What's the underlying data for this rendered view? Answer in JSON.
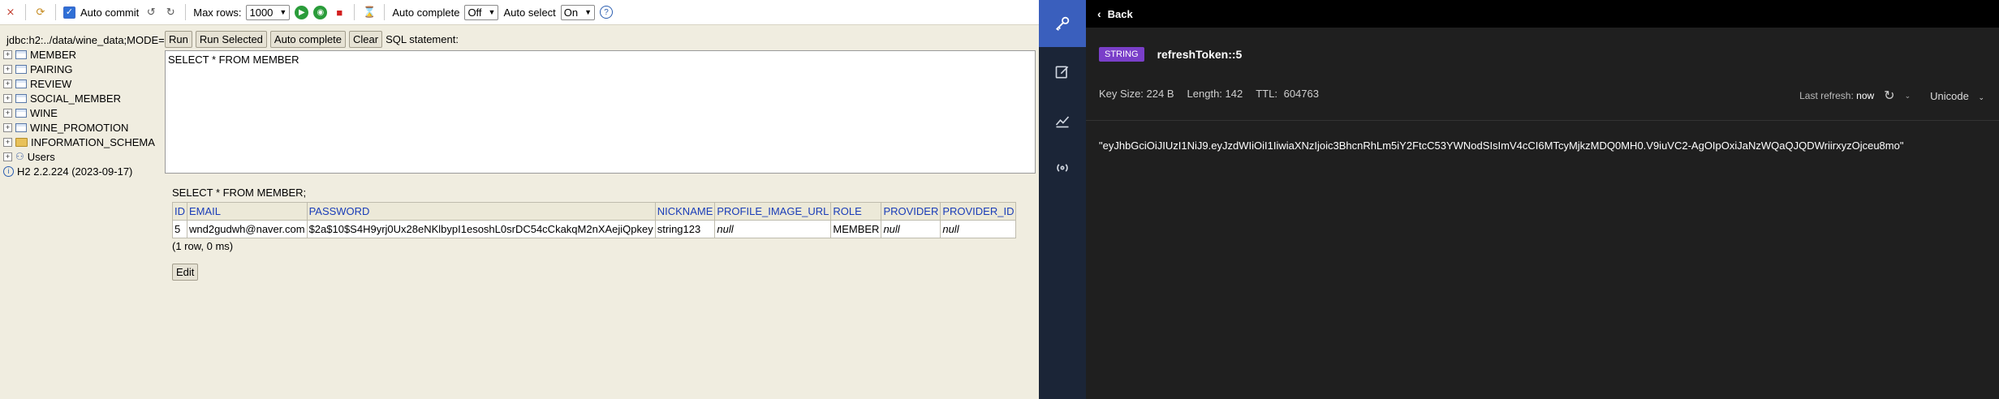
{
  "h2": {
    "toolbar": {
      "auto_commit": "Auto commit",
      "max_rows_label": "Max rows:",
      "max_rows_value": "1000",
      "auto_complete_label": "Auto complete",
      "auto_complete_value": "Off",
      "auto_select_label": "Auto select",
      "auto_select_value": "On"
    },
    "tree": {
      "connection": "jdbc:h2:../data/wine_data;MODE=",
      "tables": [
        "MEMBER",
        "PAIRING",
        "REVIEW",
        "SOCIAL_MEMBER",
        "WINE",
        "WINE_PROMOTION"
      ],
      "schema": "INFORMATION_SCHEMA",
      "users": "Users",
      "version": "H2 2.2.224 (2023-09-17)"
    },
    "sql_toolbar": {
      "run": "Run",
      "run_selected": "Run Selected",
      "auto_complete": "Auto complete",
      "clear": "Clear",
      "statement_label": "SQL statement:"
    },
    "editor_text": "SELECT * FROM MEMBER",
    "result": {
      "query": "SELECT * FROM MEMBER;",
      "columns": [
        "ID",
        "EMAIL",
        "PASSWORD",
        "NICKNAME",
        "PROFILE_IMAGE_URL",
        "ROLE",
        "PROVIDER",
        "PROVIDER_ID"
      ],
      "row": [
        "5",
        "wnd2gudwh@naver.com",
        "$2a$10$S4H9yrj0Ux28eNKlbypI1esoshL0srDC54cCkakqM2nXAejiQpkey",
        "string123",
        "null",
        "MEMBER",
        "null",
        "null"
      ],
      "summary": "(1 row, 0 ms)",
      "edit": "Edit"
    }
  },
  "redis": {
    "back": "Back",
    "type_tag": "STRING",
    "key_name": "refreshToken::5",
    "key_size_label": "Key Size:",
    "key_size": "224 B",
    "length_label": "Length:",
    "length": "142",
    "ttl_label": "TTL:",
    "ttl": "604763",
    "last_refresh_label": "Last refresh:",
    "last_refresh": "now",
    "encoding": "Unicode",
    "value": "\"eyJhbGciOiJIUzI1NiJ9.eyJzdWIiOiI1IiwiaXNzIjoic3BhcnRhLm5iY2FtcC53YWNodSIsImV4cCI6MTcyMjkzMDQ0MH0.V9iuVC2-AgOIpOxiJaNzWQaQJQDWriirxyzOjceu8mo\""
  },
  "colors": {
    "accent": "#3a5fbd",
    "tag": "#7a3fc9",
    "header_link": "#1a3db8"
  }
}
